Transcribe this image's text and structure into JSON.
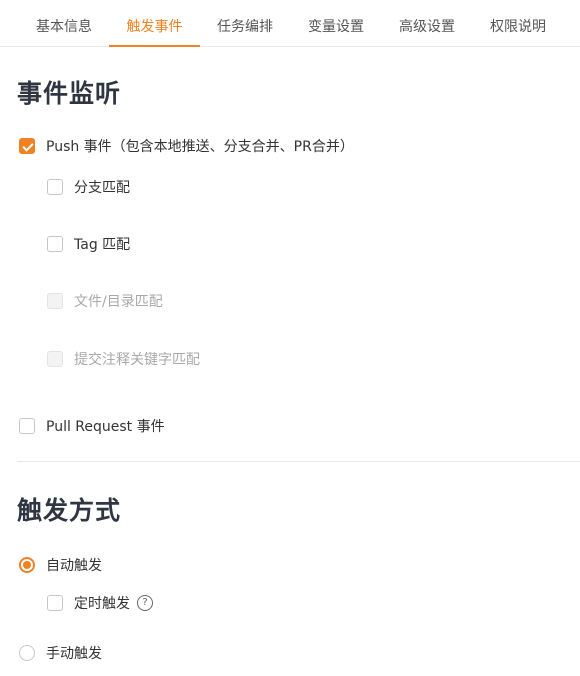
{
  "tabs": [
    {
      "label": "基本信息"
    },
    {
      "label": "触发事件"
    },
    {
      "label": "任务编排"
    },
    {
      "label": "变量设置"
    },
    {
      "label": "高级设置"
    },
    {
      "label": "权限说明"
    }
  ],
  "active_tab": "触发事件",
  "event_section": {
    "title": "事件监听",
    "push": {
      "label": "Push 事件（包含本地推送、分支合并、PR合并）",
      "checked": true
    },
    "sub_options": [
      {
        "label": "分支匹配",
        "checked": false,
        "disabled": false
      },
      {
        "label": "Tag 匹配",
        "checked": false,
        "disabled": false
      },
      {
        "label": "文件/目录匹配",
        "checked": false,
        "disabled": true
      },
      {
        "label": "提交注释关键字匹配",
        "checked": false,
        "disabled": true
      }
    ],
    "pull_request": {
      "label": "Pull Request 事件",
      "checked": false
    }
  },
  "trigger_section": {
    "title": "触发方式",
    "auto": {
      "label": "自动触发",
      "selected": true
    },
    "scheduled": {
      "label": "定时触发",
      "checked": false,
      "help_icon": "question-circle-icon",
      "help_glyph": "?"
    },
    "manual": {
      "label": "手动触发",
      "selected": false
    }
  },
  "colors": {
    "accent": "#f08224",
    "title": "#2f3642",
    "disabled_text": "#a9a9a9"
  }
}
